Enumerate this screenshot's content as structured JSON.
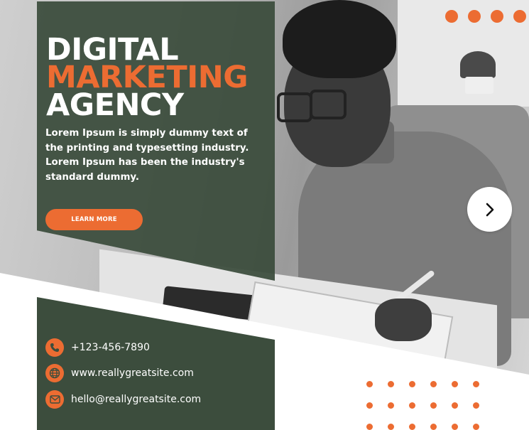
{
  "headline": {
    "line1": "DIGITAL",
    "line2": "MARKETING",
    "line3": "AGENCY"
  },
  "description": "Lorem Ipsum is simply dummy text of the printing and typesetting industry. Lorem Ipsum has been the industry's standard dummy.",
  "cta": {
    "label": "LEARN MORE"
  },
  "next_button": {
    "icon": "chevron-right-icon"
  },
  "contacts": {
    "phone": {
      "icon": "phone-icon",
      "text": "+123-456-7890"
    },
    "website": {
      "icon": "globe-icon",
      "text": "www.reallygreatsite.com"
    },
    "email": {
      "icon": "mail-icon",
      "text": "hello@reallygreatsite.com"
    }
  },
  "colors": {
    "accent": "#ec6c32",
    "panel_green": "#3c4d3d",
    "text_light": "#ffffff"
  }
}
